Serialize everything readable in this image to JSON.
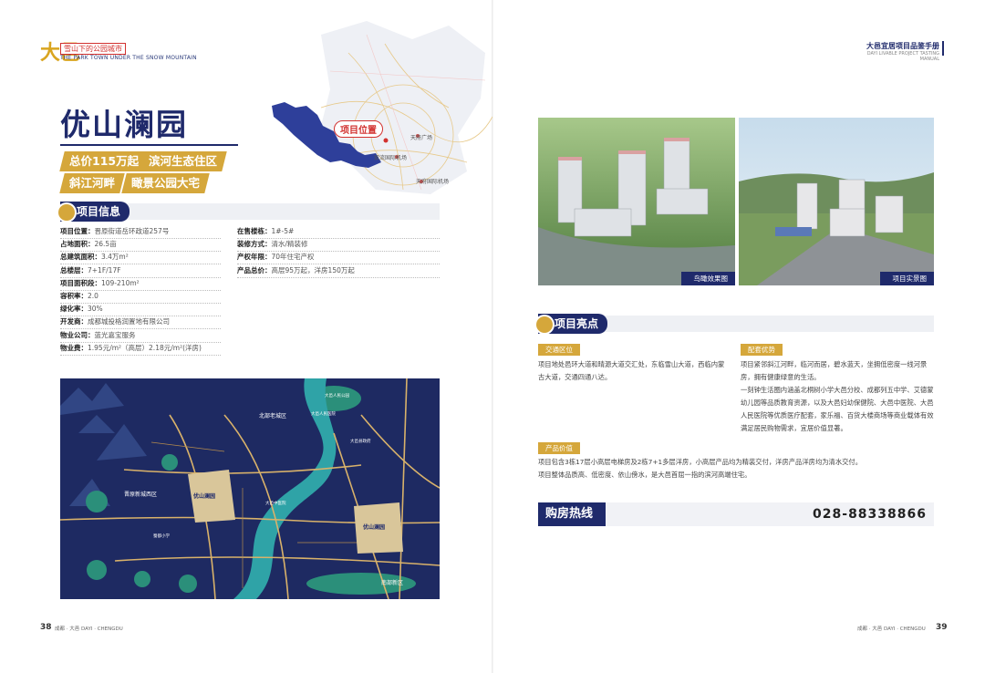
{
  "header_left": {
    "brand_char": "大邑",
    "brand_tag": "雪山下的公园城市",
    "brand_en": "THE PARK TOWN UNDER THE SNOW MOUNTAIN"
  },
  "header_right": {
    "brand_cn": "大邑宜居项目品鉴手册",
    "brand_en": "DAYI LIVABLE PROJECT TASTING MANUAL"
  },
  "project": {
    "title": "优山澜园",
    "tags": [
      "总价115万起",
      "滨河生态住区",
      "斜江河畔",
      "瞰景公园大宅"
    ]
  },
  "location_map": {
    "marker_label": "项目位置",
    "places": [
      "天府广场",
      "双流国际机场",
      "天府国际机场"
    ]
  },
  "info_section": {
    "heading": "项目信息",
    "left_rows": [
      {
        "k": "项目位置：",
        "v": "晋原街道岳环政道257号"
      },
      {
        "k": "占地面积：",
        "v": "26.5亩"
      },
      {
        "k": "总建筑面积：",
        "v": "3.4万m²"
      },
      {
        "k": "总楼层：",
        "v": "7+1F/17F"
      },
      {
        "k": "项目面积段：",
        "v": "109-210m²"
      },
      {
        "k": "容积率：",
        "v": "2.0"
      },
      {
        "k": "绿化率：",
        "v": "30%"
      },
      {
        "k": "开发商：",
        "v": "成都城投格润置地有限公司"
      },
      {
        "k": "物业公司：",
        "v": "蓝光嘉宝服务"
      },
      {
        "k": "物业费：",
        "v": "1.95元/m²（高层）2.18元/m²(洋房)"
      }
    ],
    "right_rows": [
      {
        "k": "在售楼栋：",
        "v": "1#-5#"
      },
      {
        "k": "装修方式：",
        "v": "清水/精装修"
      },
      {
        "k": "产权年限：",
        "v": "70年住宅产权"
      },
      {
        "k": "产品总价：",
        "v": "高层95万起，洋房150万起"
      }
    ]
  },
  "area_map": {
    "labels": [
      "北部老城区",
      "大邑人民医院",
      "大邑县政府",
      "晋原新城西区",
      "优山澜园",
      "大邑中医院",
      "蜀都小学",
      "优山澜园",
      "南部新区",
      "大邑人民公园"
    ]
  },
  "photos": [
    {
      "caption": "鸟瞰效果图"
    },
    {
      "caption": "项目实景图"
    }
  ],
  "highlights": {
    "heading": "项目亮点",
    "traffic": {
      "label": "交通区位",
      "text": "项目地处邑环大道和晴源大道交汇处，东临雪山大道，西临内蒙古大道，交通四通八达。"
    },
    "amenities": {
      "label": "配套优势",
      "text1": "项目紧邻斜江河畔，临河而居，碧水蓝天，坐拥低密度一线河景房，拥有健康绿意的生活。",
      "text2": "一刻钟生活圈内涵盖北桐树小学大邑分校、成都列五中学、艾德蒙幼儿园等品质教育资源，以及大邑妇幼保健院、大邑中医院、大邑人民医院等优质医疗配套，家乐福、百货大楼商场等商业载体有效满足居民购物需求，宜居价值显著。"
    },
    "value": {
      "label": "产品价值",
      "text1": "项目包含3栋17层小高层电梯房及2栋7+1多层洋房，小高层产品均为精装交付，洋房产品洋房均为清水交付。",
      "text2": "项目整体品质高、低密度、依山傍水，是大邑首屈一指的滨河高端住宅。"
    }
  },
  "hotline": {
    "label": "购房热线",
    "number": "028-88338866"
  },
  "footer": {
    "left_no": "38",
    "left_cap": "成都 · 大邑 DAYI · CHENGDU",
    "right_cap": "成都 · 大邑 DAYI · CHENGDU",
    "right_no": "39"
  },
  "colors": {
    "navy": "#1f2a6b",
    "gold": "#d5a73b",
    "map_bg": "#1e2a62",
    "river": "#2fa3a7"
  }
}
